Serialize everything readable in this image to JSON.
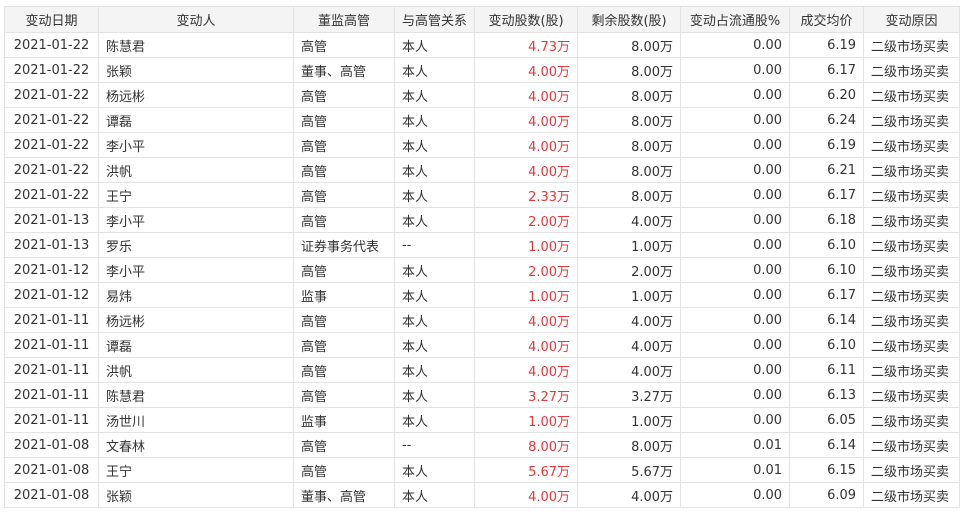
{
  "table": {
    "columns": [
      "变动日期",
      "变动人",
      "董监高管",
      "与高管关系",
      "变动股数(股)",
      "剩余股数(股)",
      "变动占流通股%",
      "成交均价",
      "变动原因"
    ],
    "rows": [
      [
        "2021-01-22",
        "陈慧君",
        "高管",
        "本人",
        "4.73万",
        "8.00万",
        "0.00",
        "6.19",
        "二级市场买卖"
      ],
      [
        "2021-01-22",
        "张颖",
        "董事、高管",
        "本人",
        "4.00万",
        "8.00万",
        "0.00",
        "6.17",
        "二级市场买卖"
      ],
      [
        "2021-01-22",
        "杨远彬",
        "高管",
        "本人",
        "4.00万",
        "8.00万",
        "0.00",
        "6.20",
        "二级市场买卖"
      ],
      [
        "2021-01-22",
        "谭磊",
        "高管",
        "本人",
        "4.00万",
        "8.00万",
        "0.00",
        "6.24",
        "二级市场买卖"
      ],
      [
        "2021-01-22",
        "李小平",
        "高管",
        "本人",
        "4.00万",
        "8.00万",
        "0.00",
        "6.19",
        "二级市场买卖"
      ],
      [
        "2021-01-22",
        "洪帆",
        "高管",
        "本人",
        "4.00万",
        "8.00万",
        "0.00",
        "6.21",
        "二级市场买卖"
      ],
      [
        "2021-01-22",
        "王宁",
        "高管",
        "本人",
        "2.33万",
        "8.00万",
        "0.00",
        "6.17",
        "二级市场买卖"
      ],
      [
        "2021-01-13",
        "李小平",
        "高管",
        "本人",
        "2.00万",
        "4.00万",
        "0.00",
        "6.18",
        "二级市场买卖"
      ],
      [
        "2021-01-13",
        "罗乐",
        "证券事务代表",
        "--",
        "1.00万",
        "1.00万",
        "0.00",
        "6.10",
        "二级市场买卖"
      ],
      [
        "2021-01-12",
        "李小平",
        "高管",
        "本人",
        "2.00万",
        "2.00万",
        "0.00",
        "6.10",
        "二级市场买卖"
      ],
      [
        "2021-01-12",
        "易炜",
        "监事",
        "本人",
        "1.00万",
        "1.00万",
        "0.00",
        "6.17",
        "二级市场买卖"
      ],
      [
        "2021-01-11",
        "杨远彬",
        "高管",
        "本人",
        "4.00万",
        "4.00万",
        "0.00",
        "6.14",
        "二级市场买卖"
      ],
      [
        "2021-01-11",
        "谭磊",
        "高管",
        "本人",
        "4.00万",
        "4.00万",
        "0.00",
        "6.10",
        "二级市场买卖"
      ],
      [
        "2021-01-11",
        "洪帆",
        "高管",
        "本人",
        "4.00万",
        "4.00万",
        "0.00",
        "6.11",
        "二级市场买卖"
      ],
      [
        "2021-01-11",
        "陈慧君",
        "高管",
        "本人",
        "3.27万",
        "3.27万",
        "0.00",
        "6.13",
        "二级市场买卖"
      ],
      [
        "2021-01-11",
        "汤世川",
        "监事",
        "本人",
        "1.00万",
        "1.00万",
        "0.00",
        "6.05",
        "二级市场买卖"
      ],
      [
        "2021-01-08",
        "文春林",
        "高管",
        "--",
        "8.00万",
        "8.00万",
        "0.01",
        "6.14",
        "二级市场买卖"
      ],
      [
        "2021-01-08",
        "王宁",
        "高管",
        "本人",
        "5.67万",
        "5.67万",
        "0.01",
        "6.15",
        "二级市场买卖"
      ],
      [
        "2021-01-08",
        "张颖",
        "董事、高管",
        "本人",
        "4.00万",
        "4.00万",
        "0.00",
        "6.09",
        "二级市场买卖"
      ]
    ]
  },
  "colors": {
    "change_value": "#e4393c",
    "header_bg": "#f4f4f4",
    "border": "#e3e3e3"
  }
}
